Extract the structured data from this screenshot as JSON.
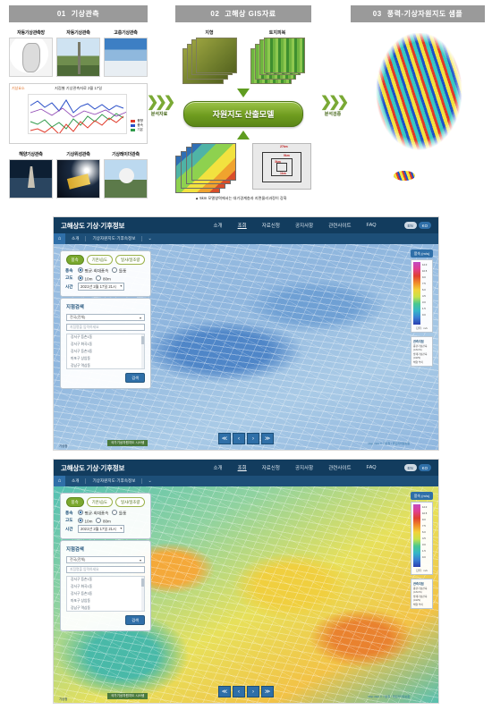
{
  "diagram": {
    "columns": [
      {
        "num": "01",
        "title": "기상관측",
        "top_thumbs": [
          {
            "label": "자동기상관측망",
            "icon": "map-thumb"
          },
          {
            "label": "자동기상관측",
            "icon": "tower-photo"
          },
          {
            "label": "고층기상관측",
            "icon": "cloud-photo"
          }
        ],
        "chart": {
          "title": "지점별 기상관측자료 2월 17일",
          "ytag": "기상요소",
          "legend": [
            {
              "name": "풍향",
              "color": "#e03a2a"
            },
            {
              "name": "풍속",
              "color": "#2a4fc8"
            },
            {
              "name": "기온",
              "color": "#2f9a4a"
            }
          ]
        },
        "bottom_thumbs": [
          {
            "label": "해양기상관측",
            "icon": "buoy-photo"
          },
          {
            "label": "기상위성관측",
            "icon": "satellite-photo"
          },
          {
            "label": "기상레이더관측",
            "icon": "radar-photo"
          }
        ]
      },
      {
        "num": "02",
        "title": "고해상 GIS자료",
        "stacks": [
          {
            "label": "지형",
            "icon": "terrain-raster-stack"
          },
          {
            "label": "토지피복",
            "icon": "landcover-raster-stack"
          }
        ],
        "model_box": "자원지도 산출모델",
        "nest_labels": [
          "27km",
          "9km",
          "3km",
          "1km"
        ],
        "caption": "▲ 5km 모델영역에서는 대기경계층과 지면물리과정이 강화"
      },
      {
        "num": "03",
        "title": "풍력-기상자원지도 샘플"
      }
    ],
    "connectors": [
      {
        "label": "분석자료",
        "icon": "chevrons-right-icon"
      },
      {
        "label": "분석검증",
        "icon": "chevrons-right-icon"
      }
    ]
  },
  "site": {
    "brand": "고해상도 기상·기후정보",
    "nav": [
      "소개",
      "조회",
      "자료신청",
      "공지사항",
      "관련사이트",
      "FAQ"
    ],
    "nav_active": "조회",
    "nav_buttons": [
      {
        "label": "EN",
        "active": false
      },
      {
        "label": "KO",
        "active": true
      }
    ],
    "breadcrumb": {
      "home_icon": "home-icon",
      "items": [
        "소개",
        "기상자원지도·기후속정보"
      ],
      "caret": "⌄"
    }
  },
  "panel": {
    "tabs": [
      {
        "label": "풍속",
        "active": true
      },
      {
        "label": "기온/습도",
        "active": false
      },
      {
        "label": "일사/일조량",
        "active": false
      }
    ],
    "rows": [
      {
        "key": "풍속",
        "options": [
          {
            "label": "평균·최대풍속",
            "checked": true
          },
          {
            "label": "돌풍",
            "checked": false
          }
        ]
      },
      {
        "key": "고도",
        "options": [
          {
            "label": "10m",
            "checked": true
          },
          {
            "label": "80m",
            "checked": false
          }
        ]
      },
      {
        "key": "시간",
        "select": "2021년 2월 17일 21시"
      }
    ]
  },
  "search": {
    "title": "지점검색",
    "region_select": "전국(전체)",
    "placeholder": "지점명을 입력하세요",
    "results": [
      "강서구 등촌1동",
      "강서구 화곡1동",
      "강서구 등촌3동",
      "마포구 상암동",
      "강남구 역삼동"
    ],
    "button": "검색"
  },
  "legend": {
    "title": "풍속 (m/s)",
    "ticks": [
      "12.0",
      "10.5",
      "9.0",
      "7.5",
      "6.0",
      "4.5",
      "3.0",
      "1.5",
      "0.0"
    ],
    "footer": "단위 : m/s",
    "sub": {
      "header": "관측지점",
      "rows": [
        "종관기상관측 (ASOS)",
        "방재기상관측 (AWS)",
        "해양 부이"
      ]
    }
  },
  "playback": {
    "buttons": [
      {
        "icon": "skip-back-icon",
        "glyph": "≪"
      },
      {
        "icon": "step-back-icon",
        "glyph": "‹"
      },
      {
        "icon": "step-forward-icon",
        "glyph": "›"
      },
      {
        "icon": "skip-forward-icon",
        "glyph": "≫"
      }
    ]
  },
  "map_footer": {
    "watermark": "국가기상자원지도 시스템",
    "logo": "기상청",
    "attribution": "Map data © 기상청 / 국토지리정보원"
  },
  "colors": {
    "nav_bg": "#123c5e",
    "crumb_bg": "#1d4f78",
    "accent": "#2f6fa8",
    "green": "#7aa82e",
    "header_gray": "#9a9a9a"
  }
}
